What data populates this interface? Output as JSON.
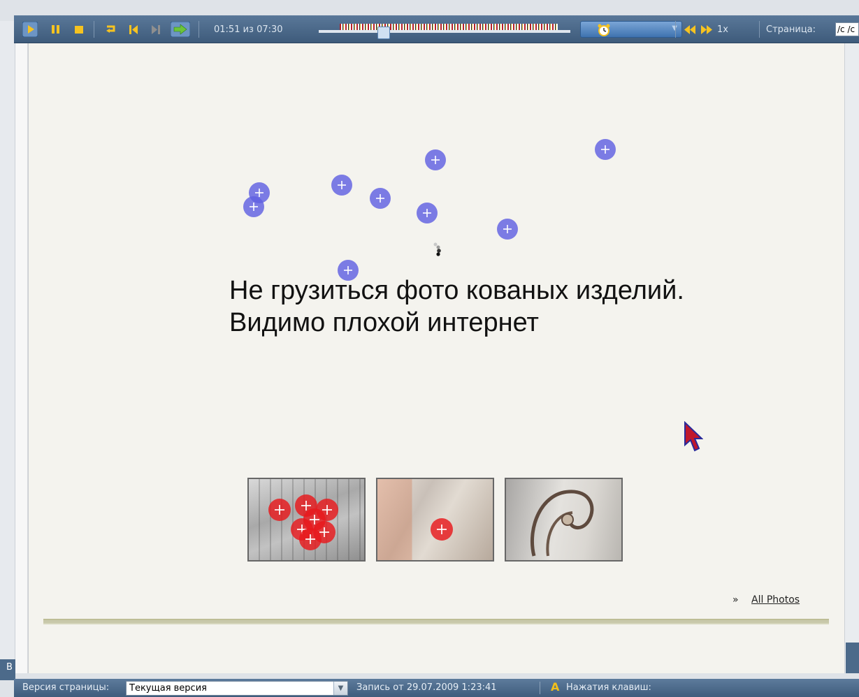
{
  "player": {
    "time_current": "01:51",
    "time_separator": "из",
    "time_total": "07:30",
    "time_label": "01:51 из 07:30",
    "speed": "1x",
    "page_label": "Страница:",
    "page_value": "/c /c",
    "timeline_progress": 0.247
  },
  "annotation": {
    "line1": "Не грузиться фото кованых изделий.",
    "line2": "Видимо плохой интернет"
  },
  "gallery": {
    "more_glyph": "»",
    "link": "All Photos",
    "photos": [
      "photo-1",
      "photo-2",
      "photo-3"
    ]
  },
  "statusbar": {
    "version_label": "Версия страницы:",
    "version_value": "Текущая версия",
    "recorded": "Запись от 29.07.2009 1:23:41",
    "keys_label": "Нажатия клавиш:",
    "left_stub": "В"
  },
  "colors": {
    "toolbar": "#4a6889",
    "click_blue": "#6060e2",
    "click_red": "#e8181c",
    "page_bg": "#f4f3ee"
  },
  "icons": [
    "play-icon",
    "pause-icon",
    "stop-icon",
    "repeat-icon",
    "skip-back-icon",
    "skip-forward-icon",
    "next-arrow-icon",
    "alarm-icon",
    "rewind-icon",
    "fast-forward-icon",
    "loading-icon",
    "cursor-icon",
    "dropdown-arrow-icon",
    "keyboard-icon"
  ]
}
